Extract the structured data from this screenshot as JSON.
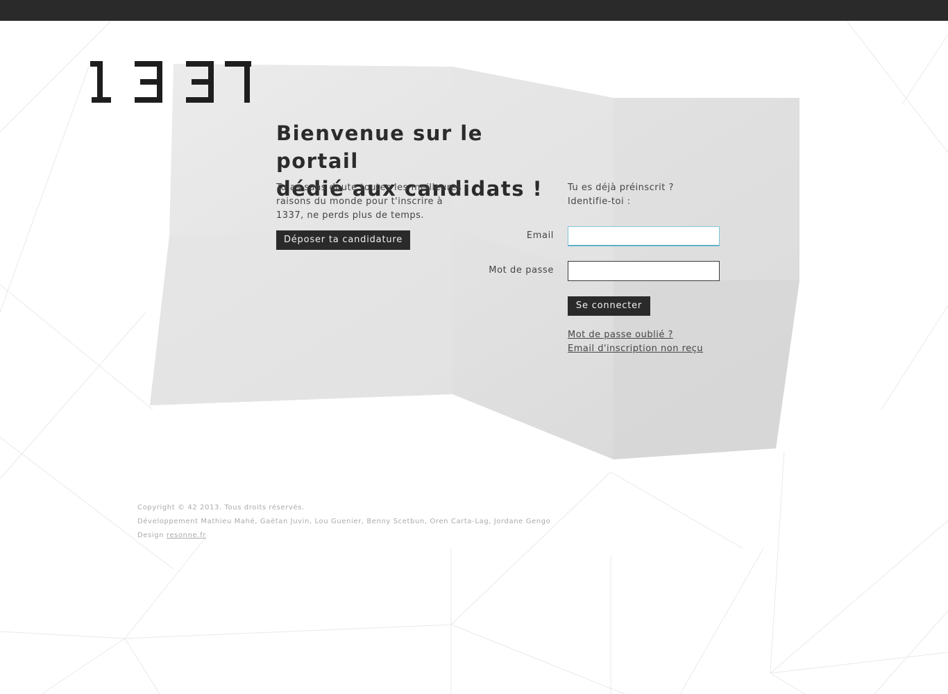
{
  "brand": {
    "logo_text": "1337"
  },
  "welcome": {
    "headline_line1": "Bienvenue sur le portail",
    "headline_line2": "dédié aux candidats !",
    "intro_line1": "Tu as sans doute toutes les meilleures",
    "intro_line2": "raisons du monde pour t'inscrire à",
    "intro_line3": "1337, ne perds plus de temps.",
    "apply_button": "Déposer ta candidature"
  },
  "login": {
    "intro_line1": "Tu es déjà préinscrit ?",
    "intro_line2": "Identifie-toi :",
    "email_label": "Email",
    "email_value": "",
    "password_label": "Mot de passe",
    "password_value": "",
    "submit_button": "Se connecter",
    "forgot_link": "Mot de passe oublié ?",
    "resend_link": "Email d'inscription non reçu"
  },
  "footer": {
    "copyright": "Copyright © 42 2013. Tous droits réservés.",
    "developers": "Développement Mathieu Mahé, Gaëtan Juvin, Lou Guenier, Benny Scetbun, Oren Carta-Lag, Jordane Gengo",
    "design_prefix": "Design ",
    "design_link": "resonne.fr"
  },
  "colors": {
    "topbar": "#2a2a2a",
    "panel": "#e2e2e2",
    "button": "#2a2a2a",
    "focus_accent": "#3b9db3"
  }
}
